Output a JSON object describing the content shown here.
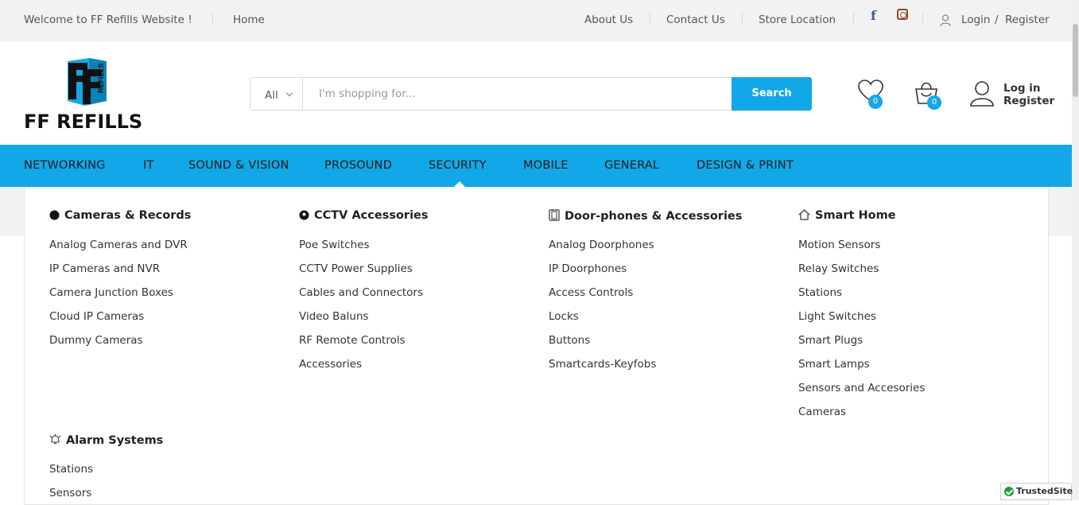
{
  "topbar": {
    "welcome": "Welcome to FF Refills Website !",
    "home": "Home",
    "about": "About Us",
    "contact": "Contact Us",
    "store": "Store Location",
    "login": "Login",
    "slash": "/",
    "register": "Register"
  },
  "logo": {
    "text": "FF REFILLS",
    "sub": "REFILLS"
  },
  "search": {
    "category": "All",
    "placeholder": "I'm shopping for...",
    "button": "Search"
  },
  "header": {
    "wishlist_count": "0",
    "cart_count": "0",
    "login": "Log in",
    "register": "Register"
  },
  "nav": [
    "NETWORKING",
    "IT",
    "SOUND & VISION",
    "PROSOUND",
    "SECURITY",
    "MOBILE",
    "GENERAL",
    "DESIGN & PRINT"
  ],
  "mega": {
    "cameras": {
      "title": "Cameras & Records",
      "items": [
        "Analog Cameras and DVR",
        "IP Cameras and NVR",
        "Camera Junction Boxes",
        "Cloud IP Cameras",
        "Dummy Cameras"
      ]
    },
    "cctv": {
      "title": "CCTV Accessories",
      "items": [
        "Poe Switches",
        "CCTV Power Supplies",
        "Cables and Connectors",
        "Video Baluns",
        "RF Remote Controls",
        "Accessories"
      ]
    },
    "door": {
      "title": "Door-phones & Accessories",
      "items": [
        "Analog Doorphones",
        "IP Doorphones",
        "Access Controls",
        "Locks",
        "Buttons",
        "Smartcards-Keyfobs"
      ]
    },
    "smart": {
      "title": "Smart Home",
      "items": [
        "Motion Sensors",
        "Relay Switches",
        "Stations",
        "Light Switches",
        "Smart Plugs",
        "Smart Lamps",
        "Sensors and Accesories",
        "Cameras"
      ]
    },
    "alarm": {
      "title": "Alarm Systems",
      "items": [
        "Stations",
        "Sensors"
      ]
    }
  },
  "trusted": "TrustedSite",
  "colors": {
    "accent": "#12a8e8",
    "topbar_bg": "#f2f2f2"
  }
}
